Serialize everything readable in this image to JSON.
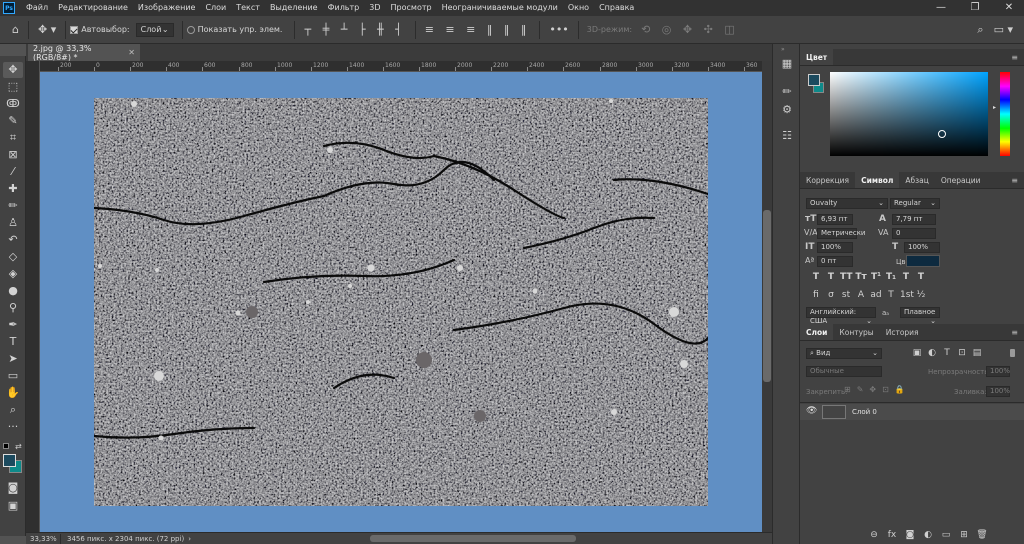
{
  "app": {
    "logo": "Ps"
  },
  "menu": [
    "Файл",
    "Редактирование",
    "Изображение",
    "Слои",
    "Текст",
    "Выделение",
    "Фильтр",
    "3D",
    "Просмотр",
    "Неограничиваемые модули",
    "Окно",
    "Справка"
  ],
  "window_controls": {
    "minimize": "—",
    "restore": "❐",
    "close": "✕"
  },
  "options": {
    "autoselect_label": "Автовыбор:",
    "autoselect_checked": true,
    "autoselect_target": "Слой",
    "show_transform_label": "Показать упр. элем.",
    "show_transform_checked": false,
    "mode_3d_label": "3D-режим:"
  },
  "document": {
    "tab_title": "2.jpg @ 33,3% (RGB/8#) *",
    "zoom": "33,33%",
    "doc_info": "3456 пикс. x 2304 пикс. (72 ppi)"
  },
  "ruler_labels": [
    "200",
    "0",
    "200",
    "400",
    "600",
    "800",
    "1000",
    "1200",
    "1400",
    "1600",
    "1800",
    "2000",
    "2200",
    "2400",
    "2600",
    "2800",
    "3000",
    "3200",
    "3400",
    "360"
  ],
  "color_panel": {
    "title": "Цвет",
    "foreground": "#1c4a5e",
    "background": "#0e8a8a",
    "field_hue": "#00a3ff"
  },
  "character_panel": {
    "tabs": [
      "Коррекция",
      "Символ",
      "Абзац",
      "Операции"
    ],
    "active_tab": "Символ",
    "font_family": "Ouvalty",
    "font_style": "Regular",
    "font_size": "6,93 пт",
    "leading": "7,79 пт",
    "kerning": "Метрически",
    "tracking": "0",
    "vertical_scale": "100%",
    "horizontal_scale": "100%",
    "baseline_shift": "0 пт",
    "color_label": "Цвет:",
    "text_color": "#0d2a3f",
    "style_glyphs_row1": [
      "T",
      "T",
      "TT",
      "Tт",
      "T¹",
      "T₁",
      "T",
      "T"
    ],
    "style_glyphs_row2": [
      "fi",
      "σ",
      "st",
      "A",
      "ad",
      "T",
      "1st",
      "½"
    ],
    "language": "Английский: США",
    "antialias_label": "aₐ",
    "antialias": "Плавное"
  },
  "layers_panel": {
    "tabs": [
      "Слои",
      "Контуры",
      "История"
    ],
    "active_tab": "Слои",
    "filter_label": "Вид",
    "blend_mode": "Обычные",
    "opacity_label": "Непрозрачность:",
    "opacity_value": "100%",
    "lock_label": "Закрепить:",
    "fill_label": "Заливка:",
    "fill_value": "100%",
    "layers": [
      {
        "name": "Слой 0",
        "visible": true
      }
    ]
  }
}
